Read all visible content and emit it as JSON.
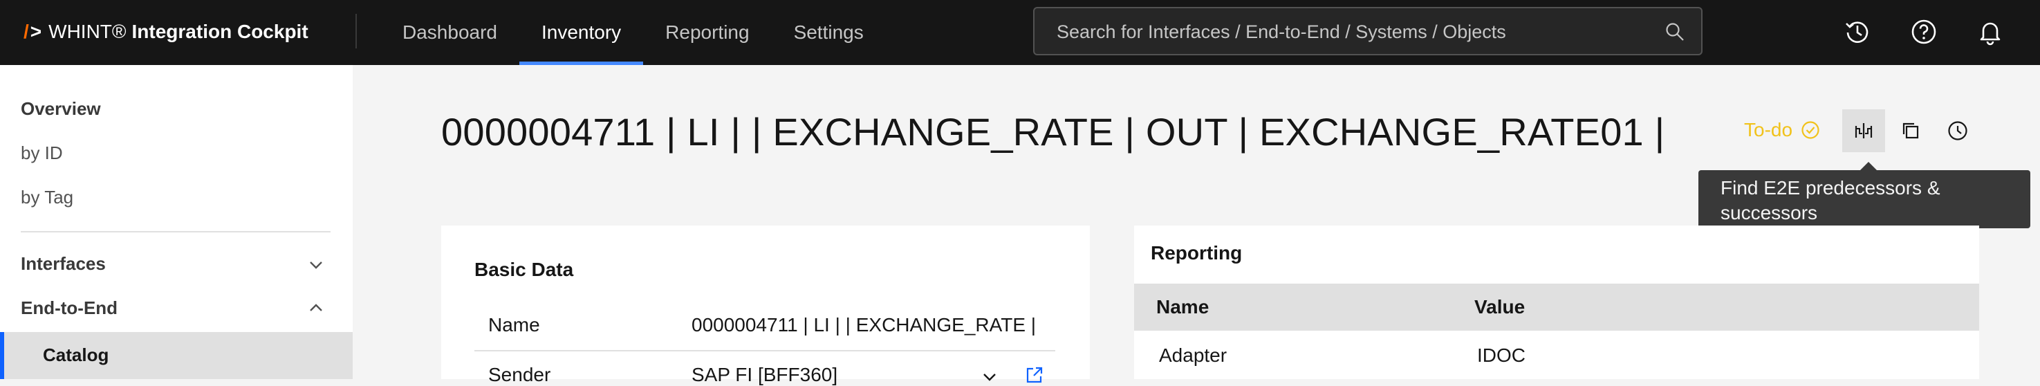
{
  "header": {
    "logo_slash": "/",
    "logo_gt": ">",
    "brand": "WHINT®",
    "product": "Integration Cockpit",
    "nav": [
      "Dashboard",
      "Inventory",
      "Reporting",
      "Settings"
    ],
    "active_nav": "Inventory",
    "search_placeholder": "Search for Interfaces / End-to-End / Systems / Objects",
    "icons": [
      "history-icon",
      "help-icon",
      "notification-icon"
    ]
  },
  "sidebar": {
    "overview": "Overview",
    "by_id": "by ID",
    "by_tag": "by Tag",
    "interfaces": "Interfaces",
    "end_to_end": "End-to-End",
    "catalog": "Catalog"
  },
  "main": {
    "title": "0000004711 | LI | | EXCHANGE_RATE | OUT | EXCHANGE_RATE01 |",
    "status": "To-do",
    "tooltip": "Find E2E predecessors & successors",
    "basic_data": {
      "title": "Basic Data",
      "rows": [
        {
          "label": "Name",
          "value": "0000004711 | LI |  | EXCHANGE_RATE |"
        },
        {
          "label": "Sender",
          "value": "SAP FI [BFF360]"
        }
      ]
    },
    "reporting": {
      "title": "Reporting",
      "columns": [
        "Name",
        "Value"
      ],
      "rows": [
        {
          "name": "Adapter",
          "value": "IDOC"
        }
      ]
    }
  },
  "colors": {
    "header_bg": "#161616",
    "accent": "#0f62fe",
    "nav_underline": "#4589ff",
    "status_todo": "#f1c21b",
    "tooltip_bg": "#393939"
  }
}
